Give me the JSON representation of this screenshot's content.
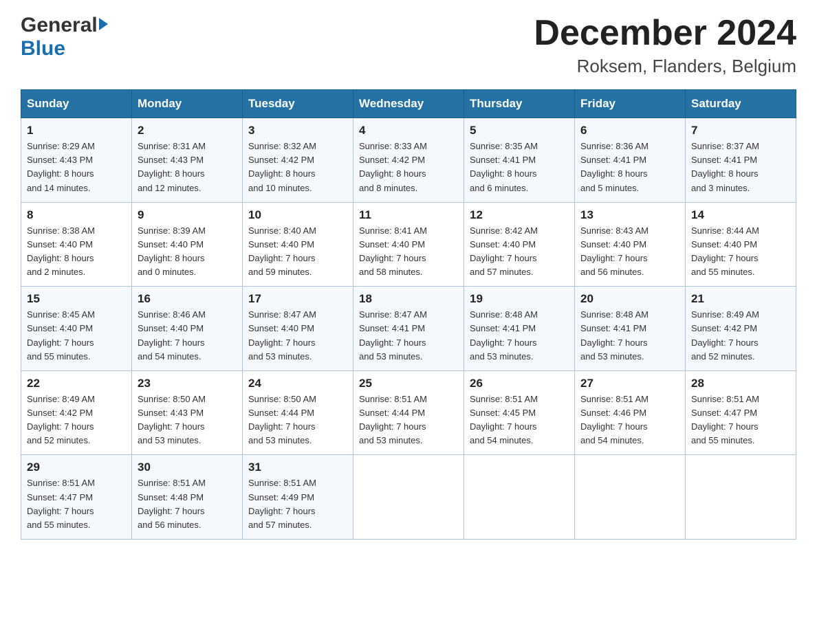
{
  "header": {
    "logo_general": "General",
    "logo_blue": "Blue",
    "month_title": "December 2024",
    "location": "Roksem, Flanders, Belgium"
  },
  "days_of_week": [
    "Sunday",
    "Monday",
    "Tuesday",
    "Wednesday",
    "Thursday",
    "Friday",
    "Saturday"
  ],
  "weeks": [
    [
      {
        "day": "1",
        "sunrise": "Sunrise: 8:29 AM",
        "sunset": "Sunset: 4:43 PM",
        "daylight": "Daylight: 8 hours",
        "daylight2": "and 14 minutes."
      },
      {
        "day": "2",
        "sunrise": "Sunrise: 8:31 AM",
        "sunset": "Sunset: 4:43 PM",
        "daylight": "Daylight: 8 hours",
        "daylight2": "and 12 minutes."
      },
      {
        "day": "3",
        "sunrise": "Sunrise: 8:32 AM",
        "sunset": "Sunset: 4:42 PM",
        "daylight": "Daylight: 8 hours",
        "daylight2": "and 10 minutes."
      },
      {
        "day": "4",
        "sunrise": "Sunrise: 8:33 AM",
        "sunset": "Sunset: 4:42 PM",
        "daylight": "Daylight: 8 hours",
        "daylight2": "and 8 minutes."
      },
      {
        "day": "5",
        "sunrise": "Sunrise: 8:35 AM",
        "sunset": "Sunset: 4:41 PM",
        "daylight": "Daylight: 8 hours",
        "daylight2": "and 6 minutes."
      },
      {
        "day": "6",
        "sunrise": "Sunrise: 8:36 AM",
        "sunset": "Sunset: 4:41 PM",
        "daylight": "Daylight: 8 hours",
        "daylight2": "and 5 minutes."
      },
      {
        "day": "7",
        "sunrise": "Sunrise: 8:37 AM",
        "sunset": "Sunset: 4:41 PM",
        "daylight": "Daylight: 8 hours",
        "daylight2": "and 3 minutes."
      }
    ],
    [
      {
        "day": "8",
        "sunrise": "Sunrise: 8:38 AM",
        "sunset": "Sunset: 4:40 PM",
        "daylight": "Daylight: 8 hours",
        "daylight2": "and 2 minutes."
      },
      {
        "day": "9",
        "sunrise": "Sunrise: 8:39 AM",
        "sunset": "Sunset: 4:40 PM",
        "daylight": "Daylight: 8 hours",
        "daylight2": "and 0 minutes."
      },
      {
        "day": "10",
        "sunrise": "Sunrise: 8:40 AM",
        "sunset": "Sunset: 4:40 PM",
        "daylight": "Daylight: 7 hours",
        "daylight2": "and 59 minutes."
      },
      {
        "day": "11",
        "sunrise": "Sunrise: 8:41 AM",
        "sunset": "Sunset: 4:40 PM",
        "daylight": "Daylight: 7 hours",
        "daylight2": "and 58 minutes."
      },
      {
        "day": "12",
        "sunrise": "Sunrise: 8:42 AM",
        "sunset": "Sunset: 4:40 PM",
        "daylight": "Daylight: 7 hours",
        "daylight2": "and 57 minutes."
      },
      {
        "day": "13",
        "sunrise": "Sunrise: 8:43 AM",
        "sunset": "Sunset: 4:40 PM",
        "daylight": "Daylight: 7 hours",
        "daylight2": "and 56 minutes."
      },
      {
        "day": "14",
        "sunrise": "Sunrise: 8:44 AM",
        "sunset": "Sunset: 4:40 PM",
        "daylight": "Daylight: 7 hours",
        "daylight2": "and 55 minutes."
      }
    ],
    [
      {
        "day": "15",
        "sunrise": "Sunrise: 8:45 AM",
        "sunset": "Sunset: 4:40 PM",
        "daylight": "Daylight: 7 hours",
        "daylight2": "and 55 minutes."
      },
      {
        "day": "16",
        "sunrise": "Sunrise: 8:46 AM",
        "sunset": "Sunset: 4:40 PM",
        "daylight": "Daylight: 7 hours",
        "daylight2": "and 54 minutes."
      },
      {
        "day": "17",
        "sunrise": "Sunrise: 8:47 AM",
        "sunset": "Sunset: 4:40 PM",
        "daylight": "Daylight: 7 hours",
        "daylight2": "and 53 minutes."
      },
      {
        "day": "18",
        "sunrise": "Sunrise: 8:47 AM",
        "sunset": "Sunset: 4:41 PM",
        "daylight": "Daylight: 7 hours",
        "daylight2": "and 53 minutes."
      },
      {
        "day": "19",
        "sunrise": "Sunrise: 8:48 AM",
        "sunset": "Sunset: 4:41 PM",
        "daylight": "Daylight: 7 hours",
        "daylight2": "and 53 minutes."
      },
      {
        "day": "20",
        "sunrise": "Sunrise: 8:48 AM",
        "sunset": "Sunset: 4:41 PM",
        "daylight": "Daylight: 7 hours",
        "daylight2": "and 53 minutes."
      },
      {
        "day": "21",
        "sunrise": "Sunrise: 8:49 AM",
        "sunset": "Sunset: 4:42 PM",
        "daylight": "Daylight: 7 hours",
        "daylight2": "and 52 minutes."
      }
    ],
    [
      {
        "day": "22",
        "sunrise": "Sunrise: 8:49 AM",
        "sunset": "Sunset: 4:42 PM",
        "daylight": "Daylight: 7 hours",
        "daylight2": "and 52 minutes."
      },
      {
        "day": "23",
        "sunrise": "Sunrise: 8:50 AM",
        "sunset": "Sunset: 4:43 PM",
        "daylight": "Daylight: 7 hours",
        "daylight2": "and 53 minutes."
      },
      {
        "day": "24",
        "sunrise": "Sunrise: 8:50 AM",
        "sunset": "Sunset: 4:44 PM",
        "daylight": "Daylight: 7 hours",
        "daylight2": "and 53 minutes."
      },
      {
        "day": "25",
        "sunrise": "Sunrise: 8:51 AM",
        "sunset": "Sunset: 4:44 PM",
        "daylight": "Daylight: 7 hours",
        "daylight2": "and 53 minutes."
      },
      {
        "day": "26",
        "sunrise": "Sunrise: 8:51 AM",
        "sunset": "Sunset: 4:45 PM",
        "daylight": "Daylight: 7 hours",
        "daylight2": "and 54 minutes."
      },
      {
        "day": "27",
        "sunrise": "Sunrise: 8:51 AM",
        "sunset": "Sunset: 4:46 PM",
        "daylight": "Daylight: 7 hours",
        "daylight2": "and 54 minutes."
      },
      {
        "day": "28",
        "sunrise": "Sunrise: 8:51 AM",
        "sunset": "Sunset: 4:47 PM",
        "daylight": "Daylight: 7 hours",
        "daylight2": "and 55 minutes."
      }
    ],
    [
      {
        "day": "29",
        "sunrise": "Sunrise: 8:51 AM",
        "sunset": "Sunset: 4:47 PM",
        "daylight": "Daylight: 7 hours",
        "daylight2": "and 55 minutes."
      },
      {
        "day": "30",
        "sunrise": "Sunrise: 8:51 AM",
        "sunset": "Sunset: 4:48 PM",
        "daylight": "Daylight: 7 hours",
        "daylight2": "and 56 minutes."
      },
      {
        "day": "31",
        "sunrise": "Sunrise: 8:51 AM",
        "sunset": "Sunset: 4:49 PM",
        "daylight": "Daylight: 7 hours",
        "daylight2": "and 57 minutes."
      },
      null,
      null,
      null,
      null
    ]
  ]
}
